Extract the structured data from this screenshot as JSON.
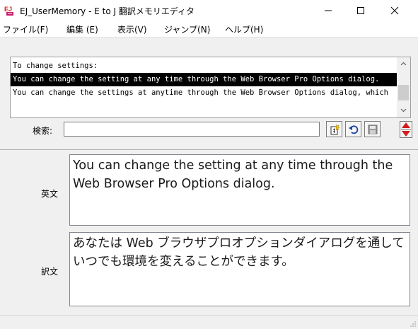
{
  "window": {
    "title": "EJ_UserMemory - E to J 翻訳メモリエディタ"
  },
  "menu": {
    "items": [
      {
        "label": "ファイル(F)"
      },
      {
        "label": "編集 (E)"
      },
      {
        "label": "表示(V)"
      },
      {
        "label": "ジャンプ(N)"
      },
      {
        "label": "ヘルプ(H)"
      }
    ]
  },
  "memory_list": {
    "rows": [
      {
        "text": "To change settings:",
        "selected": false
      },
      {
        "text": "You can change the setting at any time through the Web Browser Pro Options dialog.",
        "selected": true
      },
      {
        "text": "You can change the settings at anytime through the Web Browser Options dialog, which",
        "selected": false
      }
    ]
  },
  "search": {
    "label": "検索:",
    "value": ""
  },
  "english": {
    "label": "英文",
    "text": "You can change the setting at any time through the Web Browser Pro Options dialog."
  },
  "translation": {
    "label": "訳文",
    "text": "あなたは Web ブラウザプロオプションダイアログを通していつでも環境を変えることができます。"
  },
  "icons": {
    "app": "ej-app-icon",
    "new_entry": "new-entry-icon",
    "undo": "undo-icon",
    "save": "save-icon",
    "move": "up-down-arrows-icon"
  },
  "colors": {
    "selection": "#000000",
    "accent_red": "#d21f1f"
  }
}
